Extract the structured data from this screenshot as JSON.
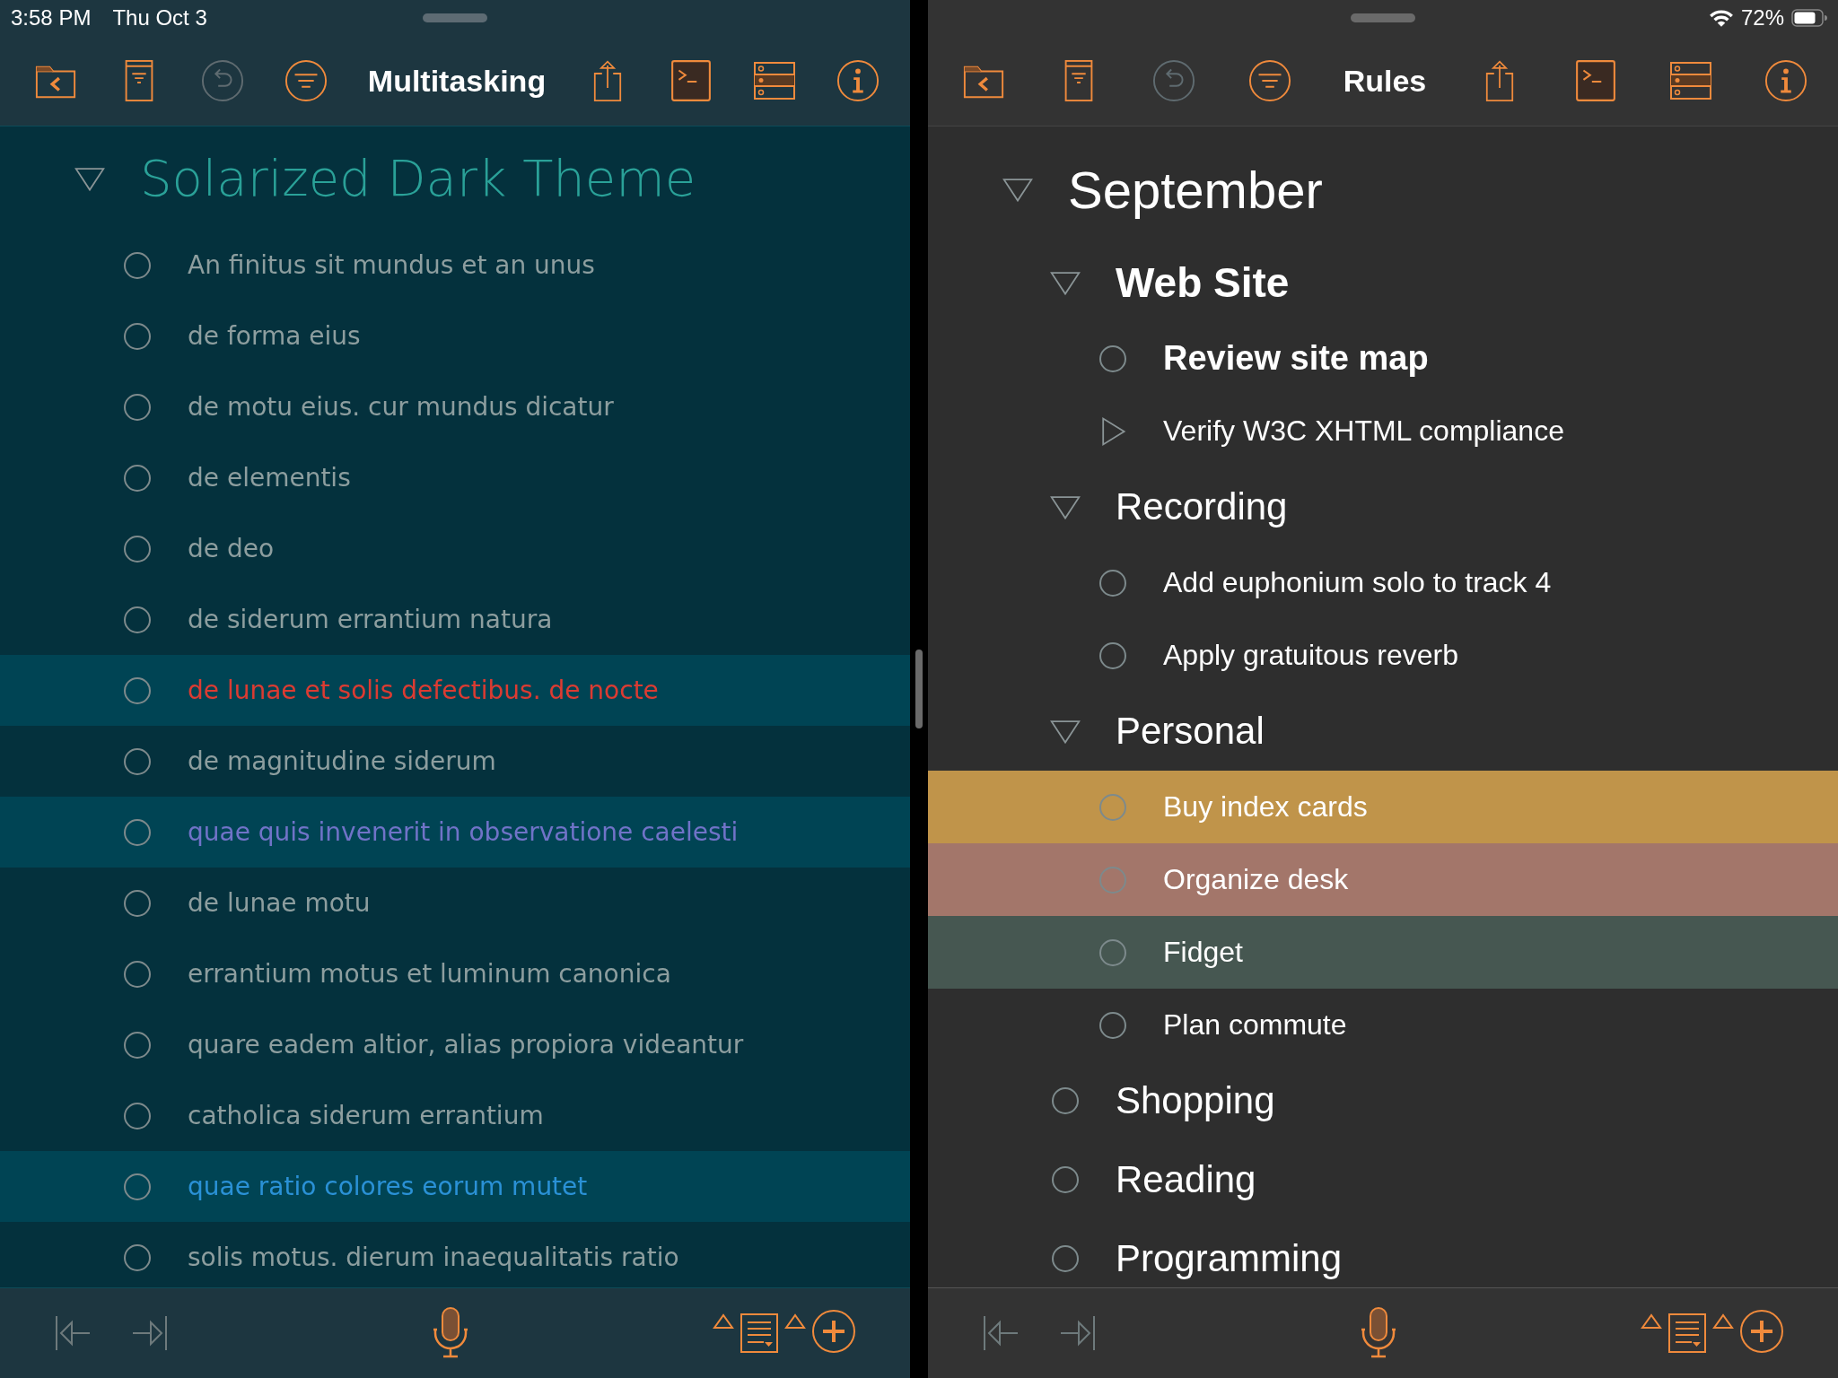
{
  "status_bar": {
    "time": "3:58 PM",
    "date": "Thu Oct 3",
    "battery": "72%"
  },
  "panes": [
    {
      "title": "Multitasking",
      "undo_enabled": false,
      "outline": {
        "kind": "group",
        "text": "Solarized Dark Theme",
        "expanded": true,
        "children": [
          {
            "kind": "item",
            "text": "An finitus sit mundus et an unus",
            "color": "#8d9e9f"
          },
          {
            "kind": "item",
            "text": "de forma eius",
            "color": "#8d9e9f"
          },
          {
            "kind": "item",
            "text": "de motu eius. cur mundus dicatur",
            "color": "#8d9e9f"
          },
          {
            "kind": "item",
            "text": "de elementis",
            "color": "#8d9e9f"
          },
          {
            "kind": "item",
            "text": "de deo",
            "color": "#8d9e9f"
          },
          {
            "kind": "item",
            "text": "de siderum errantium natura",
            "color": "#8d9e9f"
          },
          {
            "kind": "item",
            "text": "de lunae et solis defectibus. de nocte",
            "color": "#dc3b32",
            "highlighted": true
          },
          {
            "kind": "item",
            "text": "de magnitudine siderum",
            "color": "#8d9e9f"
          },
          {
            "kind": "item",
            "text": "quae quis invenerit in observatione caelesti",
            "color": "#7073c8",
            "highlighted": true
          },
          {
            "kind": "item",
            "text": "de lunae motu",
            "color": "#8d9e9f"
          },
          {
            "kind": "item",
            "text": "errantium motus et luminum canonica",
            "color": "#8d9e9f"
          },
          {
            "kind": "item",
            "text": "quare eadem altior, alias propiora videantur",
            "color": "#8d9e9f"
          },
          {
            "kind": "item",
            "text": "catholica siderum errantium",
            "color": "#8d9e9f"
          },
          {
            "kind": "item",
            "text": "quae ratio colores eorum mutet",
            "color": "#2a91d6",
            "highlighted": true
          },
          {
            "kind": "item",
            "text": "solis motus. dierum inaequalitatis ratio",
            "color": "#8d9e9f"
          }
        ]
      }
    },
    {
      "title": "Rules",
      "undo_enabled": false,
      "outline": {
        "kind": "group",
        "text": "September",
        "bold": false,
        "expanded": true,
        "children": [
          {
            "kind": "group",
            "text": "Web Site",
            "bold": true,
            "expanded": true,
            "children": [
              {
                "kind": "item",
                "text": "Review site map",
                "bold": true
              },
              {
                "kind": "group",
                "text": "Verify W3C XHTML compliance",
                "bold": false,
                "expanded": false
              }
            ]
          },
          {
            "kind": "group",
            "text": "Recording",
            "bold": false,
            "expanded": true,
            "children": [
              {
                "kind": "item",
                "text": "Add euphonium solo to track 4",
                "bold": false
              },
              {
                "kind": "item",
                "text": "Apply gratuitous reverb",
                "bold": false
              }
            ]
          },
          {
            "kind": "group",
            "text": "Personal",
            "bold": false,
            "expanded": true,
            "children": [
              {
                "kind": "item",
                "text": "Buy index cards",
                "bold": false,
                "color": "#c0944a"
              },
              {
                "kind": "item",
                "text": "Organize desk",
                "bold": false,
                "color": "#a3766a"
              },
              {
                "kind": "item",
                "text": "Fidget",
                "bold": false,
                "color": "#465751"
              },
              {
                "kind": "item",
                "text": "Plan commute",
                "bold": false
              }
            ]
          },
          {
            "kind": "item",
            "text": "Shopping",
            "bold": false
          },
          {
            "kind": "item",
            "text": "Reading",
            "bold": false
          },
          {
            "kind": "item",
            "text": "Programming",
            "bold": false
          }
        ]
      }
    }
  ]
}
